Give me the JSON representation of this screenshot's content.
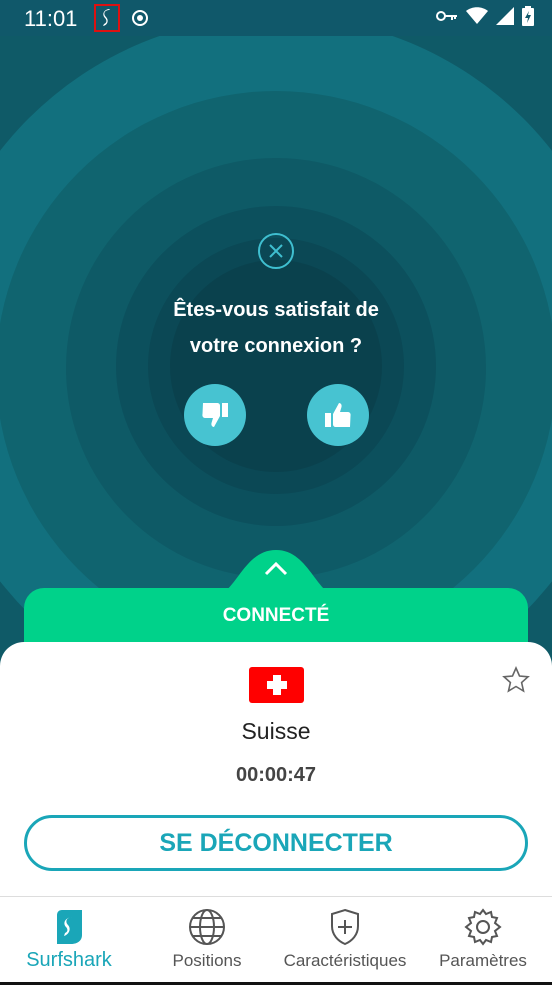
{
  "status_bar": {
    "time": "11:01",
    "icons": [
      "surfshark-app-icon",
      "record-icon",
      "vpn-key-icon",
      "wifi-icon",
      "signal-icon",
      "battery-icon"
    ]
  },
  "feedback": {
    "question_line1": "Êtes-vous satisfait de",
    "question_line2": "votre connexion ?"
  },
  "connection": {
    "status_label": "CONNECTÉ",
    "country": "Suisse",
    "elapsed": "00:00:47",
    "disconnect_label": "SE DÉCONNECTER"
  },
  "nav": {
    "items": [
      {
        "label": "Surfshark",
        "icon": "surfshark-logo-icon",
        "active": true
      },
      {
        "label": "Positions",
        "icon": "globe-icon",
        "active": false
      },
      {
        "label": "Caractéristiques",
        "icon": "shield-plus-icon",
        "active": false
      },
      {
        "label": "Paramètres",
        "icon": "gear-icon",
        "active": false
      }
    ]
  },
  "colors": {
    "accent": "#1aa6b8",
    "connected_green": "#00d28a",
    "flag_red": "#ff0000",
    "hero_bg": "#0f5a67"
  }
}
